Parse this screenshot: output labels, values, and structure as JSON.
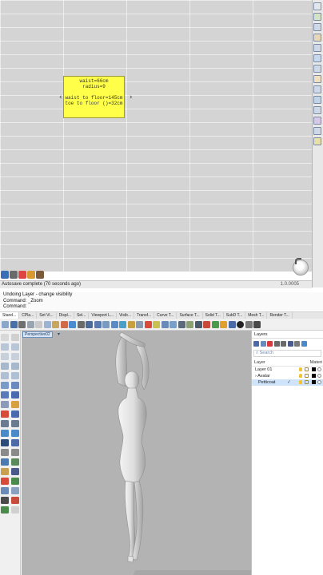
{
  "grasshopper": {
    "panel": {
      "lines": [
        "waist=66cm",
        "radius=9",
        "",
        "waist to floor=145cm",
        "toe to floor ()=32cm"
      ]
    },
    "status": {
      "message": "Autosave complete (70 seconds ago)",
      "version": "1.0.0005"
    },
    "colors": {
      "canvas": "#d4d4d4",
      "panel": "#ffff4a"
    }
  },
  "rhino": {
    "command_history": {
      "line1": "Undoing Layer - change visibility",
      "line2": "Command: _Zoom",
      "prompt": "Command:"
    },
    "tabs": [
      "Stand...",
      "CPla...",
      "Set Vi...",
      "Displ...",
      "Sel...",
      "Viewport L...",
      "Visib...",
      "Transf...",
      "Curve T...",
      "Surface T...",
      "Solid T...",
      "SubD T...",
      "Mesh T...",
      "Render T..."
    ],
    "viewport": {
      "label": "Perspective02",
      "dropdown_glyph": "▾",
      "background": "#b3b3b3"
    },
    "layers_panel": {
      "title": "Layers",
      "search_placeholder": "Search",
      "column_layer": "Layer",
      "column_material": "Materi",
      "rows": [
        {
          "name": "Layer 01",
          "expand": ""
        },
        {
          "name": "Avatar",
          "expand": "›"
        },
        {
          "name": "Petticoat",
          "expand": "",
          "selected": true,
          "check": "✓"
        }
      ]
    }
  }
}
